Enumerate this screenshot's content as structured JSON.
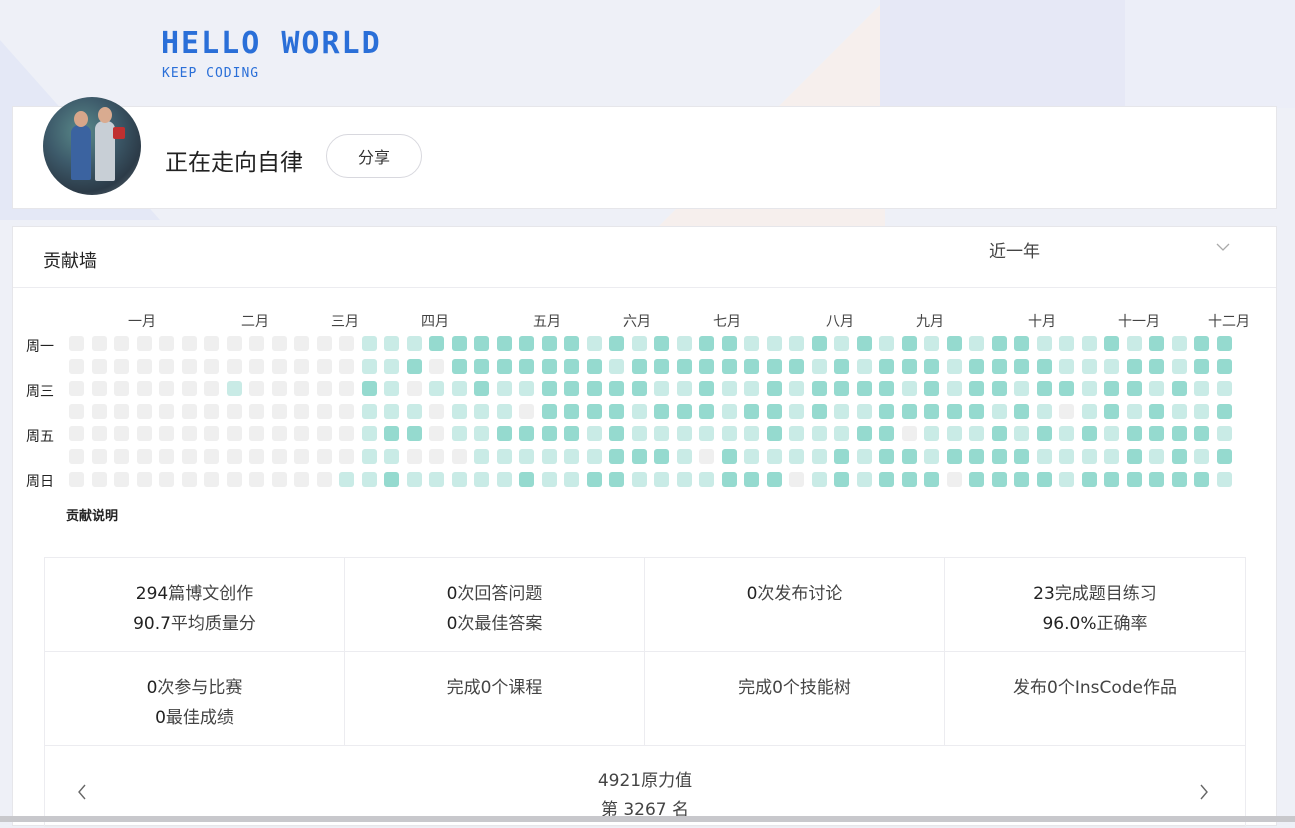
{
  "banner": {
    "title": "HELLO WORLD",
    "subtitle": "KEEP CODING"
  },
  "profile": {
    "name": "正在走向自律",
    "share_label": "分享"
  },
  "contrib": {
    "title": "贡献墙",
    "range": "近一年",
    "months": [
      "一月",
      "二月",
      "三月",
      "四月",
      "五月",
      "六月",
      "七月",
      "八月",
      "九月",
      "十月",
      "十一月",
      "十二月"
    ],
    "weekdays": [
      "周一",
      "周三",
      "周五",
      "周日"
    ],
    "legend": "贡献说明",
    "levels": [
      "0000000000000111222222212121221112121212122111212122",
      "0000000000000112022222221222222221212221222211122122",
      "0000000100000210112112222211211212222121221221221211",
      "0000000000000111011102222122212212112222212101212112",
      "0000000000000122011222212111111211122011121212122221",
      "0000000000000110001111112221021111212212222111121212",
      "0000000000001121111121122111122201212220222212222221"
    ],
    "colors": {
      "empty": "#efefef",
      "low": "#c9ebe6",
      "high": "#95dacf"
    }
  },
  "stats": [
    {
      "line1_num": "294",
      "line1_text": "篇博文创作",
      "line2_num": "90.7",
      "line2_text": "平均质量分"
    },
    {
      "line1_num": "0",
      "line1_text": "次回答问题",
      "line2_num": "0",
      "line2_text": "次最佳答案"
    },
    {
      "line1_num": "0",
      "line1_text": "次发布讨论",
      "line2_num": "",
      "line2_text": ""
    },
    {
      "line1_num": "23",
      "line1_text": "完成题目练习",
      "line2_num": "96.0%",
      "line2_text": "正确率"
    },
    {
      "line1_num": "0",
      "line1_text": "次参与比赛",
      "line2_num": "0",
      "line2_text": "最佳成绩"
    },
    {
      "line1_num": "",
      "line1_text": "完成0个课程",
      "line2_num": "",
      "line2_text": ""
    },
    {
      "line1_num": "",
      "line1_text": "完成0个技能树",
      "line2_num": "",
      "line2_text": ""
    },
    {
      "line1_num": "",
      "line1_text": "发布0个InsCode作品",
      "line2_num": "",
      "line2_text": ""
    }
  ],
  "rank": {
    "power": "4921原力值",
    "position": "第 3267 名"
  },
  "icons": {
    "prev": "chevron-left-icon",
    "next": "chevron-right-icon",
    "dropdown": "chevron-down-icon"
  }
}
